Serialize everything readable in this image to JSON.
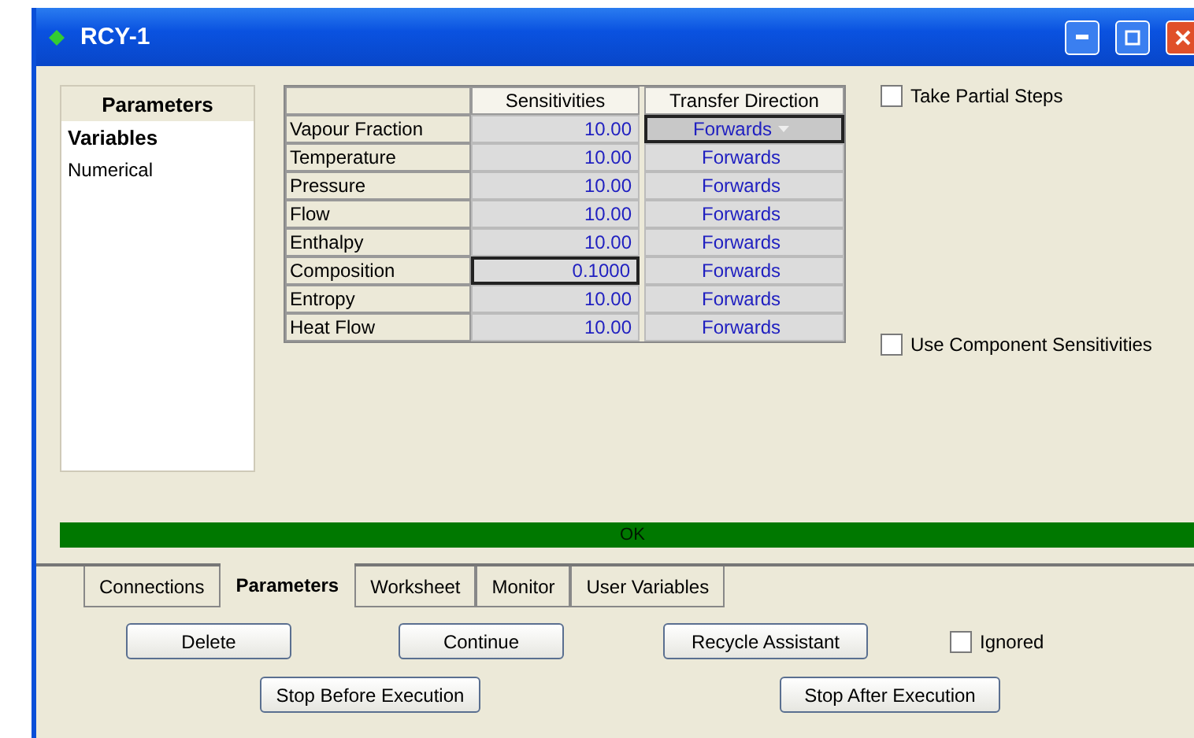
{
  "window": {
    "title": "RCY-1"
  },
  "side_panel": {
    "title": "Parameters",
    "items": [
      {
        "label": "Variables",
        "selected": true
      },
      {
        "label": "Numerical",
        "selected": false
      }
    ]
  },
  "table": {
    "columns": [
      "Sensitivities",
      "Transfer Direction"
    ],
    "rows": [
      {
        "name": "Vapour Fraction",
        "sensitivity": "10.00",
        "direction": "Forwards",
        "sensitivity_focused": false,
        "direction_focused": true
      },
      {
        "name": "Temperature",
        "sensitivity": "10.00",
        "direction": "Forwards",
        "sensitivity_focused": false,
        "direction_focused": false
      },
      {
        "name": "Pressure",
        "sensitivity": "10.00",
        "direction": "Forwards",
        "sensitivity_focused": false,
        "direction_focused": false
      },
      {
        "name": "Flow",
        "sensitivity": "10.00",
        "direction": "Forwards",
        "sensitivity_focused": false,
        "direction_focused": false
      },
      {
        "name": "Enthalpy",
        "sensitivity": "10.00",
        "direction": "Forwards",
        "sensitivity_focused": false,
        "direction_focused": false
      },
      {
        "name": "Composition",
        "sensitivity": "0.1000",
        "direction": "Forwards",
        "sensitivity_focused": true,
        "direction_focused": false
      },
      {
        "name": "Entropy",
        "sensitivity": "10.00",
        "direction": "Forwards",
        "sensitivity_focused": false,
        "direction_focused": false
      },
      {
        "name": "Heat Flow",
        "sensitivity": "10.00",
        "direction": "Forwards",
        "sensitivity_focused": false,
        "direction_focused": false
      }
    ]
  },
  "options": [
    {
      "label": "Take Partial Steps",
      "checked": false
    },
    {
      "label": "Use Component Sensitivities",
      "checked": false
    }
  ],
  "status": {
    "text": "OK",
    "color": "#007800"
  },
  "tabs": [
    {
      "label": "Connections",
      "selected": false
    },
    {
      "label": "Parameters",
      "selected": true
    },
    {
      "label": "Worksheet",
      "selected": false
    },
    {
      "label": "Monitor",
      "selected": false
    },
    {
      "label": "User Variables",
      "selected": false
    }
  ],
  "buttons_row_1": [
    "Delete",
    "Continue",
    "Recycle Assistant"
  ],
  "ignored": {
    "label": "Ignored",
    "checked": false
  },
  "buttons_row_2": [
    "Stop Before Execution",
    "Stop After Execution"
  ]
}
